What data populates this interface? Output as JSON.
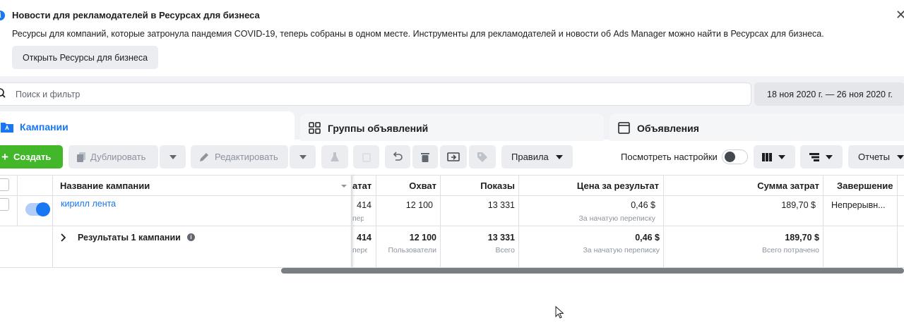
{
  "banner": {
    "info_icon": "i",
    "title": "Новости для рекламодателей в Ресурсах для бизнеса",
    "text": "Ресурсы для компаний, которые затронула пандемия COVID-19, теперь собраны в одном месте. Инструменты для рекламодателей и новости об Ads Manager можно найти в Ресурсах для бизнеса.",
    "button": "Открыть Ресурсы для бизнеса",
    "close": "✕"
  },
  "search": {
    "placeholder": "Поиск и фильтр"
  },
  "date_range": "18 ноя 2020 г. — 26 ноя 2020 г.",
  "tabs": [
    {
      "label": "Кампании",
      "icon": "folder-icon"
    },
    {
      "label": "Группы объявлений",
      "icon": "grid-icon"
    },
    {
      "label": "Объявления",
      "icon": "window-icon"
    }
  ],
  "toolbar": {
    "create": "Создать",
    "duplicate": "Дублировать",
    "edit": "Редактировать",
    "rules": "Правила",
    "view_settings": "Посмотреть настройки",
    "reports": "Отчеты"
  },
  "table": {
    "headers": {
      "name": "Название кампании",
      "results": "ататы",
      "reach": "Охват",
      "impressions": "Показы",
      "cost_per_result": "Цена за результат",
      "amount_spent": "Сумма затрат",
      "end": "Завершение"
    },
    "row": {
      "name": "кирилл лента",
      "results": "414",
      "results_sub": "пер",
      "reach": "12 100",
      "impressions": "13 331",
      "cost_per_result": "0,46 $",
      "cost_per_result_sub": "За начатую переписку",
      "amount_spent": "189,70 $",
      "end": "Непрерывн..."
    },
    "summary": {
      "label": "Результаты 1 кампании",
      "results": "414",
      "results_sub": "пере",
      "reach": "12 100",
      "reach_sub": "Пользователи",
      "impressions": "13 331",
      "impressions_sub": "Всего",
      "cost_per_result": "0,46 $",
      "cost_per_result_sub": "За начатую переписку",
      "amount_spent": "189,70 $",
      "amount_spent_sub": "Всего потрачено"
    }
  },
  "colors": {
    "accent": "#1877f2",
    "create_green": "#42b72a",
    "toggle_on": "#1877f2"
  }
}
